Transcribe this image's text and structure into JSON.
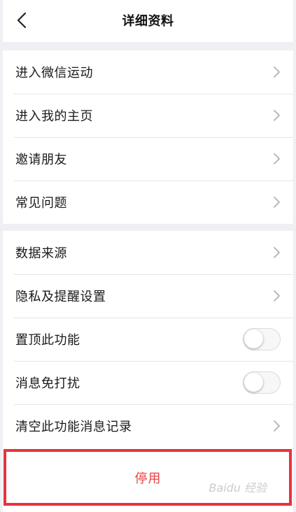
{
  "header": {
    "title": "详细资料",
    "back_icon": "chevron-left-icon"
  },
  "group1": {
    "items": [
      {
        "label": "进入微信运动",
        "icon": "chevron-right-icon"
      },
      {
        "label": "进入我的主页",
        "icon": "chevron-right-icon"
      },
      {
        "label": "邀请朋友",
        "icon": "chevron-right-icon"
      },
      {
        "label": "常见问题",
        "icon": "chevron-right-icon"
      }
    ]
  },
  "group2": {
    "items": [
      {
        "label": "数据来源",
        "icon": "chevron-right-icon"
      },
      {
        "label": "隐私及提醒设置",
        "icon": "chevron-right-icon"
      },
      {
        "label": "置顶此功能",
        "toggle": false
      },
      {
        "label": "消息免打扰",
        "toggle": false
      },
      {
        "label": "清空此功能消息记录",
        "icon": "chevron-right-icon"
      }
    ]
  },
  "stop": {
    "label": "停用",
    "color": "#e64340",
    "highlight_color": "#e8323c"
  },
  "watermark": {
    "text": "Baidu 经验"
  }
}
